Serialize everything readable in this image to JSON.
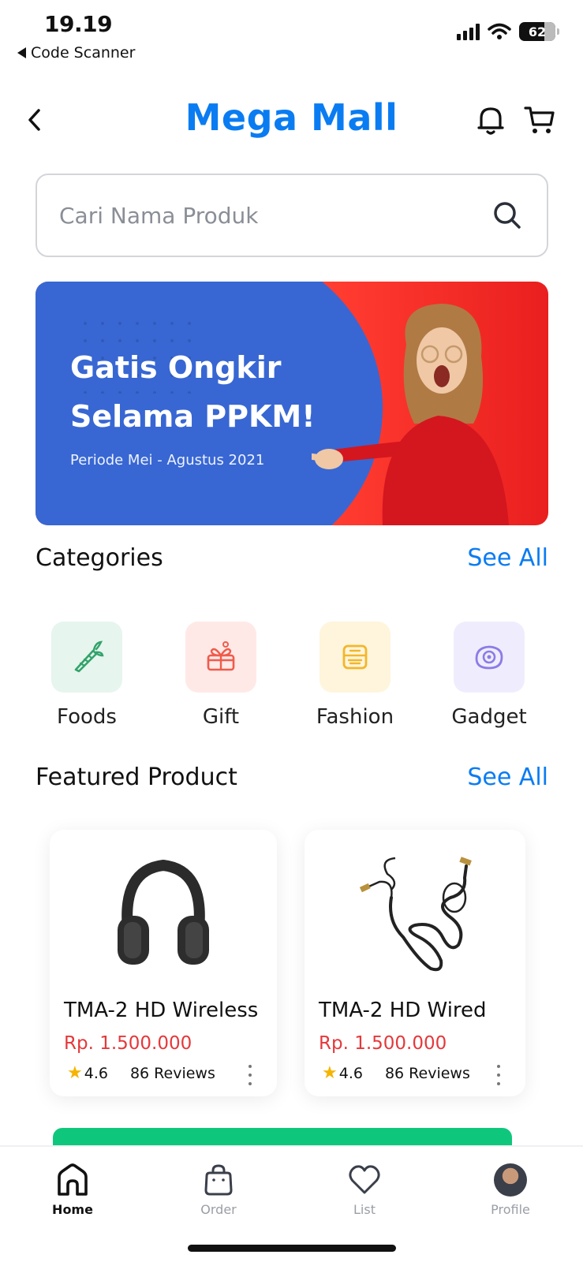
{
  "status_bar": {
    "time": "19.19",
    "back_app_label": "Code Scanner",
    "battery_level": "62"
  },
  "header": {
    "title": "Mega Mall",
    "icons": [
      "chevron-left-icon",
      "bell-icon",
      "cart-icon"
    ]
  },
  "search": {
    "placeholder": "Cari Nama Produk"
  },
  "banner": {
    "title": "Gatis Ongkir Selama PPKM!",
    "subtitle": "Periode Mei - Agustus 2021",
    "colors": {
      "left": "#3867d3",
      "right": "#ff3b30"
    }
  },
  "categories": {
    "title": "Categories",
    "see_all": "See All",
    "items": [
      {
        "label": "Foods",
        "icon": "carrot-icon",
        "bg": "#e6f5ee",
        "color": "#33a36b"
      },
      {
        "label": "Gift",
        "icon": "gift-icon",
        "bg": "#ffe9e7",
        "color": "#ef5b4b"
      },
      {
        "label": "Fashion",
        "icon": "fashion-icon",
        "bg": "#fff5dc",
        "color": "#f3b62b"
      },
      {
        "label": "Gadget",
        "icon": "gadget-icon",
        "bg": "#efedfd",
        "color": "#8b7ce6"
      }
    ]
  },
  "featured": {
    "title": "Featured Product",
    "see_all": "See All",
    "products": [
      {
        "name": "TMA-2 HD Wireless",
        "price": "Rp. 1.500.000",
        "rating": "4.6",
        "reviews": "86 Reviews",
        "image": "headphones-icon"
      },
      {
        "name": "TMA-2 HD Wired",
        "price": "Rp. 1.500.000",
        "rating": "4.6",
        "reviews": "86 Reviews",
        "image": "cable-icon"
      }
    ]
  },
  "bottom_nav": {
    "items": [
      {
        "label": "Home",
        "icon": "home-icon",
        "active": true
      },
      {
        "label": "Order",
        "icon": "bag-icon",
        "active": false
      },
      {
        "label": "List",
        "icon": "heart-icon",
        "active": false
      },
      {
        "label": "Profile",
        "icon": "avatar",
        "active": false
      }
    ]
  },
  "accent_color": "#0a7cf2",
  "price_color": "#e5383b"
}
